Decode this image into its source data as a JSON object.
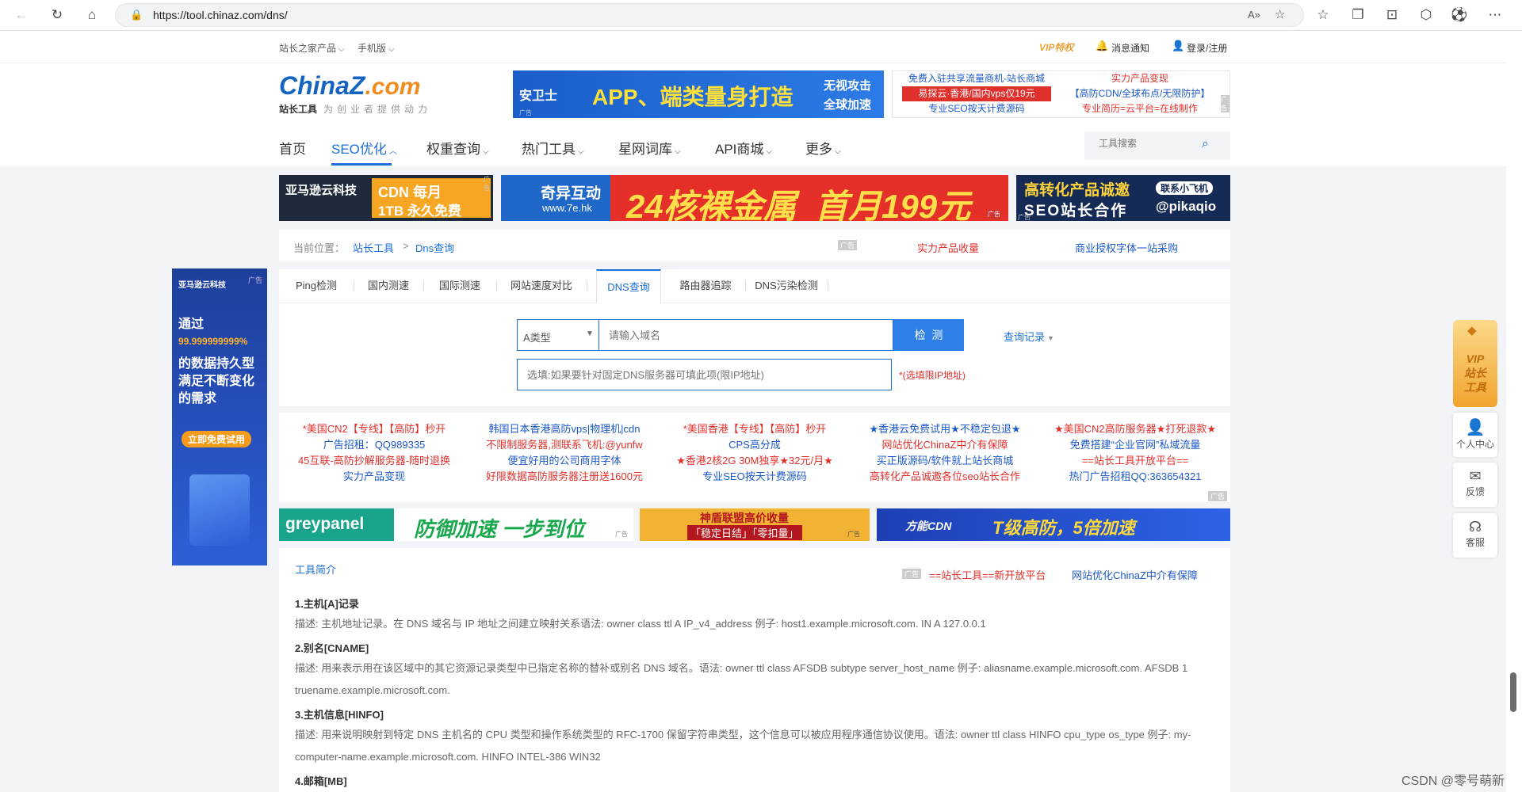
{
  "browser": {
    "url": "https://tool.chinaz.com/dns/",
    "read_aloud": "A»"
  },
  "topbar": {
    "products": "站长之家产品",
    "mobile": "手机版",
    "vip": "VIP特权",
    "notify": "消息通知",
    "login": "登录/注册"
  },
  "logo": {
    "text_china": "China",
    "text_z": "Z",
    "text_com": ".com",
    "sub": "站长工具",
    "slogan": "为创业者提供动力"
  },
  "header_ad": {
    "badge": "安卫士",
    "text": "APP、端类量身打造",
    "tag1": "无视攻击",
    "tag2": "全球加速",
    "ad": "广告"
  },
  "text_ads": {
    "rows": [
      [
        "免费入驻共享流量商机-站长商城",
        "实力产品变现"
      ],
      [
        "易探云·香港/国内vps仅19元",
        "【高防CDN/全球布点/无限防护】"
      ],
      [
        "专业SEO按天计费源码",
        "专业简历=云平台=在线制作"
      ]
    ],
    "ad": "广告"
  },
  "nav": {
    "items": [
      "首页",
      "SEO优化",
      "权重查询",
      "热门工具",
      "星网词库",
      "API商城",
      "更多"
    ],
    "search_placeholder": "工具搜索"
  },
  "banners": {
    "b1": {
      "brand": "亚马逊云科技",
      "l1": "CDN 每月",
      "l2": "1TB 永久免费",
      "ad": "广告"
    },
    "b2": {
      "brand": "奇异互动",
      "site": "www.7e.hk",
      "text": "24核裸金属  首月199元",
      "ad": "广告"
    },
    "b3": {
      "l1": "高转化产品诚邀",
      "l2": "SEO站长合作",
      "tag": "联系小飞机",
      "handle": "@pikaqio",
      "ad": "广告"
    }
  },
  "breadcrumb": {
    "label": "当前位置：",
    "home": "站长工具",
    "sep": ">",
    "current": "Dns查询",
    "ad": "广告",
    "link1": "实力产品收量",
    "link2": "商业授权字体一站采购"
  },
  "tabs": [
    "Ping检测",
    "国内测速",
    "国际测速",
    "网站速度对比",
    "DNS查询",
    "路由器追踪",
    "DNS污染检测"
  ],
  "form": {
    "type": "A类型",
    "domain_placeholder": "请输入域名",
    "check": "检  测",
    "history": "查询记录",
    "dns_placeholder": "选填:如果要针对固定DNS服务器可填此项(限IP地址)",
    "hint": "*(选填限IP地址)"
  },
  "side_ad": {
    "brand": "亚马逊云科技",
    "ad": "广告",
    "l1": "通过",
    "l2": "99.999999999%",
    "l3": "的数据持久型",
    "l4": "满足不断变化",
    "l5": "的需求",
    "cta": "立即免费试用"
  },
  "text_ads2": {
    "cols": [
      [
        "*美国CN2【专线】【高防】秒开",
        "广告招租：QQ989335",
        "45互联-高防抄解服务器-随时退换",
        "实力产品变现"
      ],
      [
        "韩国日本香港高防vps|物理机|cdn",
        "不限制服务器,测联系飞机:@yunfw",
        "便宜好用的公司商用字体",
        "好限数据高防服务器注册送1600元"
      ],
      [
        "*美国香港【专线】【高防】秒开",
        "CPS高分成",
        "★香港2核2G 30M独享★32元/月★",
        "专业SEO按天计费源码"
      ],
      [
        "★香港云免费试用★不稳定包退★",
        "网站优化ChinaZ中介有保障",
        "买正版源码/软件就上站长商城",
        "高转化产品诚邀各位seo站长合作"
      ],
      [
        "★美国CN2高防服务器★打死退款★",
        "免费搭建“企业官网”私域流量",
        "==站长工具开放平台==",
        "热门广告招租QQ:363654321"
      ]
    ],
    "ad": "广告"
  },
  "banners2": {
    "grey": {
      "logo": "greypanel",
      "text": "防御加速 一步到位",
      "ad": "广告"
    },
    "mid": {
      "l1": "神盾联盟高价收量",
      "l2": "「稳定日结」「零扣量」",
      "ad": "广告"
    },
    "fn": {
      "logo": "方能CDN",
      "text": "T级高防，5倍加速"
    }
  },
  "intro": {
    "title": "工具简介",
    "ad": "广告",
    "link1": "==站长工具==新开放平台",
    "link2": "网站优化ChinaZ中介有保障",
    "sections": [
      {
        "h": "1.主机[A]记录",
        "p": "描述: 主机地址记录。在 DNS 域名与 IP 地址之间建立映射关系语法: owner class ttl A IP_v4_address 例子: host1.example.microsoft.com. IN A 127.0.0.1"
      },
      {
        "h": "2.别名[CNAME]",
        "p": "描述: 用来表示用在该区域中的其它资源记录类型中已指定名称的替补或别名 DNS 域名。语法: owner ttl class AFSDB subtype server_host_name 例子: aliasname.example.microsoft.com. AFSDB 1 truename.example.microsoft.com."
      },
      {
        "h": "3.主机信息[HINFO]",
        "p": "描述: 用来说明映射到特定 DNS 主机名的 CPU 类型和操作系统类型的 RFC-1700 保留字符串类型，这个信息可以被应用程序通信协议使用。语法: owner ttl class HINFO cpu_type os_type 例子: my-computer-name.example.microsoft.com. HINFO INTEL-386 WIN32"
      },
      {
        "h": "4.邮箱[MB]",
        "p": ""
      }
    ]
  },
  "right_bar": {
    "vip1": "VIP",
    "vip2": "站长",
    "vip3": "工具",
    "user": "个人中心",
    "feedback": "反馈",
    "service": "客服"
  },
  "watermark": "CSDN @零号萌新"
}
